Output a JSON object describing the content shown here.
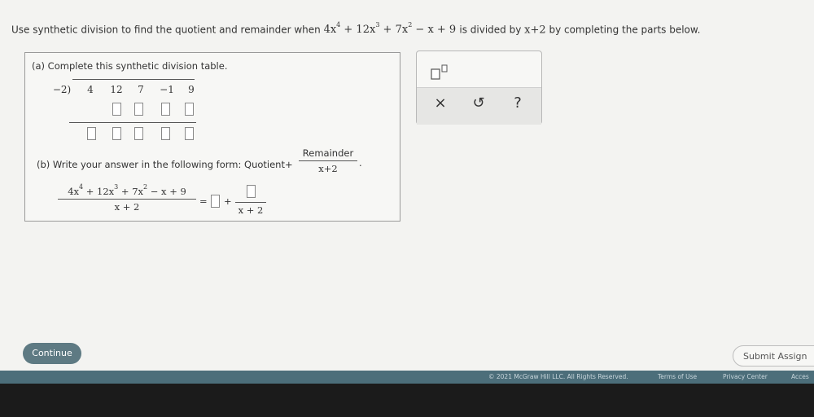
{
  "question": {
    "prefix": "Use synthetic division to find the quotient and remainder when",
    "t1": "4x",
    "e1": "4",
    "t2": "+ 12x",
    "e2": "3",
    "t3": "+ 7x",
    "e3": "2",
    "t4": "− x + 9",
    "mid": "is divided by",
    "divisor": "x+2",
    "suffix": "by completing the parts below."
  },
  "part_a": {
    "label": "(a) Complete this synthetic division table.",
    "divisor": "−2)",
    "coefficients": [
      "4",
      "12",
      "7",
      "−1",
      "9"
    ]
  },
  "part_b": {
    "label": "(b) Write your answer in the following form: Quotient+",
    "form_num": "Remainder",
    "form_den": "x+2",
    "form_end": ".",
    "lhs_t1": "4x",
    "lhs_e1": "4",
    "lhs_t2": "+ 12x",
    "lhs_e2": "3",
    "lhs_t3": "+ 7x",
    "lhs_e3": "2",
    "lhs_t4": "− x + 9",
    "lhs_den": "x + 2",
    "equals": "=",
    "plus": "+",
    "rhs_den": "x + 2"
  },
  "toolbox": {
    "clear": "×",
    "undo": "↺",
    "help": "?"
  },
  "buttons": {
    "continue": "Continue",
    "submit": "Submit Assign"
  },
  "footer": {
    "copyright": "© 2021 McGraw Hill LLC. All Rights Reserved.",
    "terms": "Terms of Use",
    "privacy": "Privacy Center",
    "access": "Acces"
  }
}
